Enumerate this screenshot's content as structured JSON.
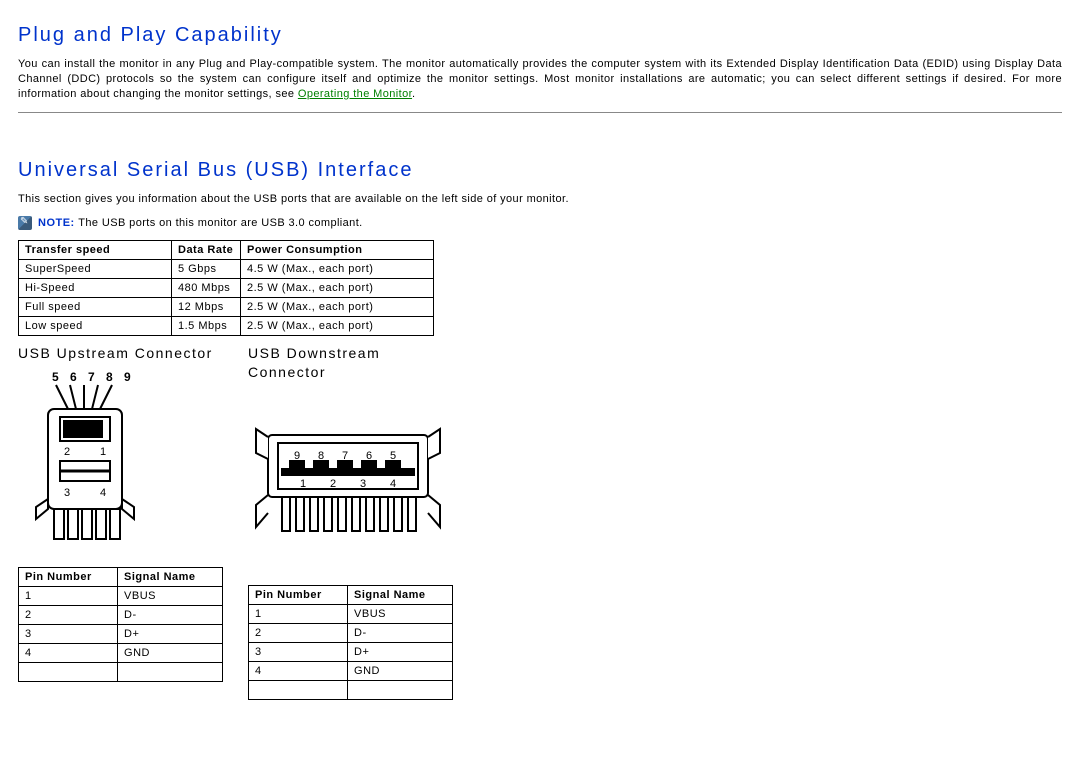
{
  "section1": {
    "title": "Plug and Play Capability",
    "paragraph_pre": "You can install the monitor in any Plug and Play-compatible system. The monitor automatically provides the computer system with its Extended Display Identification Data (EDID) using Display Data Channel (DDC) protocols so the system can configure itself and optimize the monitor settings. Most monitor installations are automatic; you can select different settings if desired. For more information about changing the monitor settings, see ",
    "link_text": "Operating the Monitor",
    "paragraph_post": "."
  },
  "section2": {
    "title": "Universal Serial Bus (USB) Interface",
    "intro": "This section gives you information about the USB ports that are available on the left side of your monitor.",
    "note_label": "NOTE:",
    "note_text": "The USB ports on this monitor are USB 3.0 compliant.",
    "speed_table": {
      "headers": [
        "Transfer speed",
        "Data Rate",
        "Power Consumption"
      ],
      "rows": [
        [
          "SuperSpeed",
          "5 Gbps",
          "4.5 W (Max., each port)"
        ],
        [
          "Hi-Speed",
          "480 Mbps",
          "2.5 W (Max., each port)"
        ],
        [
          "Full speed",
          "12 Mbps",
          "2.5 W (Max., each port)"
        ],
        [
          "Low speed",
          "1.5 Mbps",
          "2.5 W (Max., each port)"
        ]
      ]
    },
    "upstream": {
      "title": "USB Upstream Connector",
      "top_labels": "5 6 7 8 9",
      "pin_headers": [
        "Pin Number",
        "Signal Name"
      ],
      "pin_rows": [
        [
          "1",
          "VBUS"
        ],
        [
          "2",
          "D-"
        ],
        [
          "3",
          "D+"
        ],
        [
          "4",
          "GND"
        ]
      ]
    },
    "downstream": {
      "title": "USB Downstream Connector",
      "pin_headers": [
        "Pin Number",
        "Signal Name"
      ],
      "pin_rows": [
        [
          "1",
          "VBUS"
        ],
        [
          "2",
          "D-"
        ],
        [
          "3",
          "D+"
        ],
        [
          "4",
          "GND"
        ]
      ]
    }
  }
}
